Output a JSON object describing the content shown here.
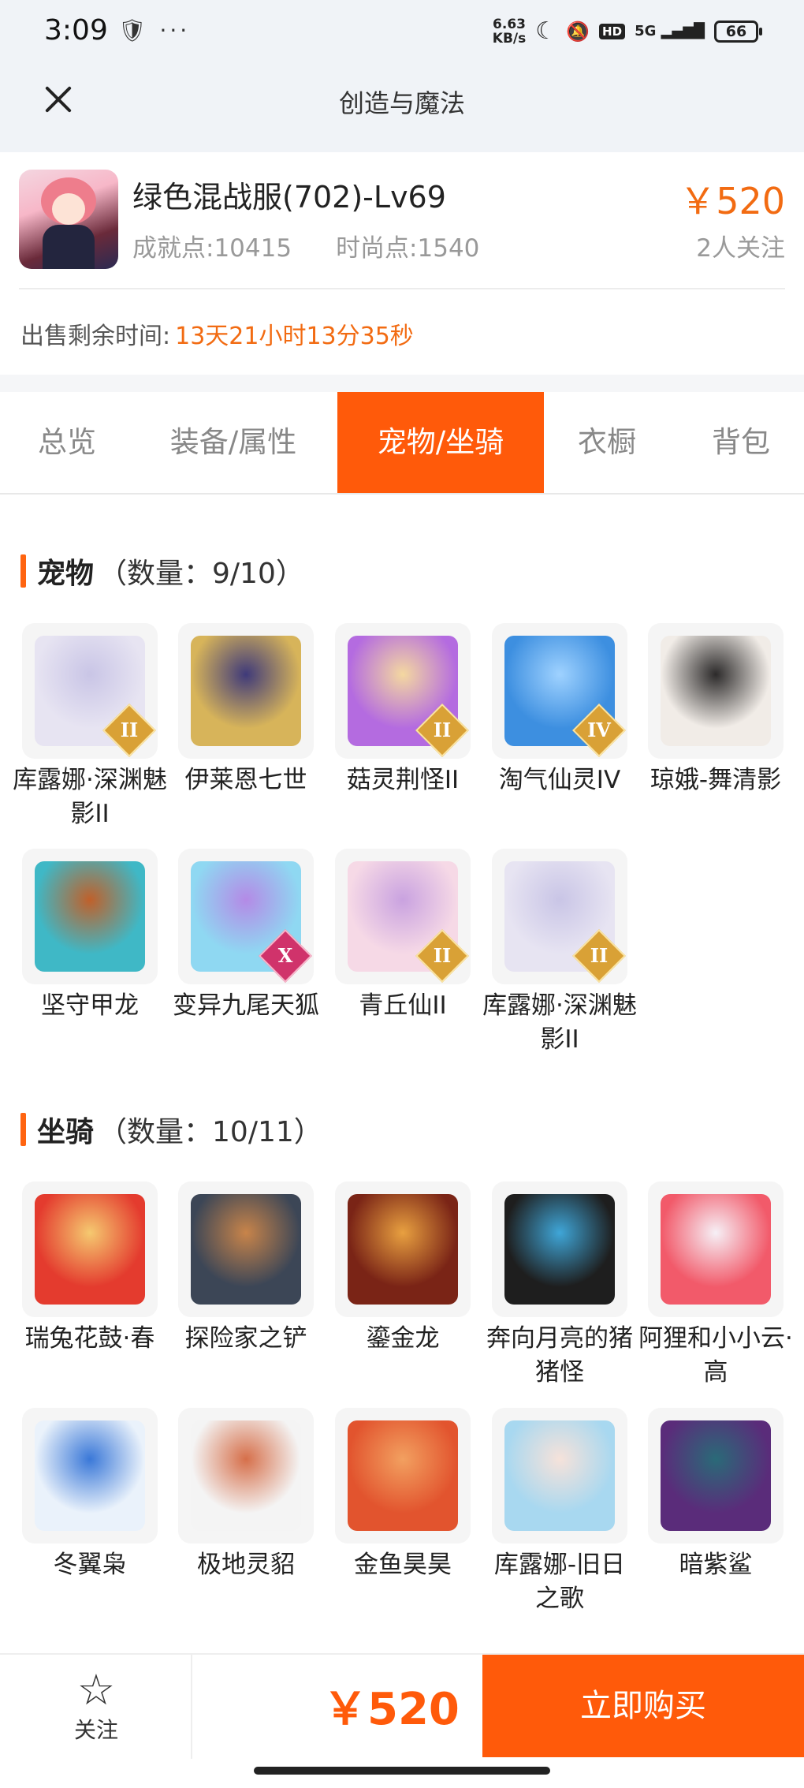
{
  "status_bar": {
    "time": "3:09",
    "left_icons": "🛡 ···",
    "net_speed_value": "6.63",
    "net_speed_unit": "KB/s",
    "moon": "☾",
    "bell_off": "🔕",
    "hd": "HD",
    "signal": "5G ▂▄▆█",
    "battery": "66"
  },
  "header": {
    "title": "创造与魔法"
  },
  "item": {
    "name": "绿色混战服(702)-Lv69",
    "achievement": "成就点:10415",
    "fashion": "时尚点:1540",
    "price": "￥520",
    "followers": "2人关注",
    "remaining_label": "出售剩余时间:",
    "remaining_value": "13天21小时13分35秒"
  },
  "tabs": [
    {
      "label": "总览"
    },
    {
      "label": "装备/属性"
    },
    {
      "label": "宠物/坐骑",
      "active": true
    },
    {
      "label": "衣橱"
    },
    {
      "label": "背包"
    }
  ],
  "pets": {
    "title": "宠物",
    "count": "（数量：9/10）",
    "items": [
      {
        "name": "库露娜·深渊魅影II",
        "badge": "II",
        "colors": [
          "#e7e4f2",
          "#c9c5e6"
        ]
      },
      {
        "name": "伊莱恩七世",
        "badge": "",
        "colors": [
          "#d7b45a",
          "#3f3a7a"
        ]
      },
      {
        "name": "菇灵荆怪II",
        "badge": "II",
        "colors": [
          "#b46be0",
          "#f4d8a0"
        ]
      },
      {
        "name": "淘气仙灵IV",
        "badge": "IV",
        "colors": [
          "#3d8fe0",
          "#9fd2ff"
        ]
      },
      {
        "name": "琼娥-舞清影",
        "badge": "",
        "colors": [
          "#f1ece7",
          "#2c2a2a"
        ]
      },
      {
        "name": "坚守甲龙",
        "badge": "",
        "colors": [
          "#3fb8c6",
          "#c0602a"
        ]
      },
      {
        "name": "变异九尾天狐",
        "badge": "X",
        "colors": [
          "#8fd8f2",
          "#b48ae6"
        ]
      },
      {
        "name": "青丘仙II",
        "badge": "II",
        "colors": [
          "#f6d9e6",
          "#c9a2e0"
        ]
      },
      {
        "name": "库露娜·深渊魅影II",
        "badge": "II",
        "colors": [
          "#e7e4f2",
          "#c9c5e6"
        ]
      }
    ]
  },
  "mounts": {
    "title": "坐骑",
    "count": "（数量：10/11）",
    "items": [
      {
        "name": "瑞兔花鼓·春",
        "colors": [
          "#e43b2e",
          "#f5c970"
        ]
      },
      {
        "name": "探险家之铲",
        "colors": [
          "#3c4656",
          "#c8844a"
        ]
      },
      {
        "name": "鎏金龙",
        "colors": [
          "#7a2416",
          "#e8a040"
        ]
      },
      {
        "name": "奔向月亮的猪猪怪",
        "colors": [
          "#1e1e1e",
          "#3fa6d8"
        ]
      },
      {
        "name": "阿狸和小小云·高",
        "colors": [
          "#f25a6a",
          "#f6f0f6"
        ]
      },
      {
        "name": "冬翼枭",
        "colors": [
          "#eaf2fb",
          "#3a78d8"
        ]
      },
      {
        "name": "极地灵貂",
        "colors": [
          "#f4f4f4",
          "#d66f4a"
        ]
      },
      {
        "name": "金鱼昊昊",
        "colors": [
          "#e2542e",
          "#f2a060"
        ]
      },
      {
        "name": "库露娜-旧日之歌",
        "colors": [
          "#a8d8f0",
          "#f6e2da"
        ]
      },
      {
        "name": "暗紫鲨",
        "colors": [
          "#5a2c7a",
          "#2a6a78"
        ]
      }
    ]
  },
  "bottom": {
    "follow_icon": "☆",
    "follow_label": "关注",
    "price": "￥520",
    "buy_label": "立即购买"
  },
  "colors": {
    "accent": "#ff5a0a",
    "price": "#f26b12"
  }
}
